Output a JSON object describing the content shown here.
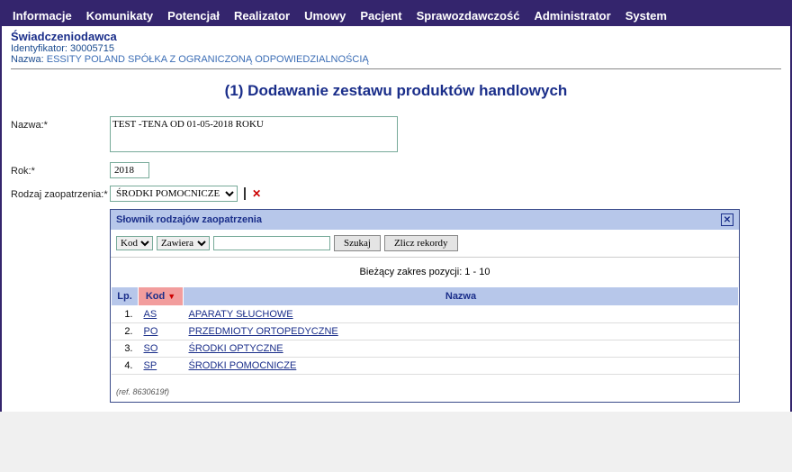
{
  "menu": {
    "items": [
      "Informacje",
      "Komunikaty",
      "Potencjał",
      "Realizator",
      "Umowy",
      "Pacjent",
      "Sprawozdawczość",
      "Administrator",
      "System"
    ]
  },
  "provider": {
    "title": "Świadczeniodawca",
    "id_label": "Identyfikator:",
    "id_value": "30005715",
    "name_label": "Nazwa:",
    "name_value": "ESSITY POLAND SPÓŁKA Z OGRANICZONĄ ODPOWIEDZIALNOŚCIĄ"
  },
  "page_title": "(1) Dodawanie zestawu produktów handlowych",
  "form": {
    "name_label": "Nazwa:*",
    "name_value": "TEST -TENA OD 01-05-2018 ROKU",
    "year_label": "Rok:*",
    "year_value": "2018",
    "supply_label": "Rodzaj zaopatrzenia:*",
    "supply_value": "ŚRODKI POMOCNICZE"
  },
  "dictionary": {
    "title": "Słownik rodzajów zaopatrzenia",
    "filter_field": "Kod",
    "filter_op": "Zawiera",
    "filter_value": "",
    "search_btn": "Szukaj",
    "count_btn": "Zlicz rekordy",
    "range_text": "Bieżący zakres pozycji: 1 - 10",
    "columns": {
      "lp": "Lp.",
      "kod": "Kod",
      "nazwa": "Nazwa"
    },
    "rows": [
      {
        "lp": "1.",
        "kod": "AS",
        "nazwa": "APARATY SŁUCHOWE"
      },
      {
        "lp": "2.",
        "kod": "PO",
        "nazwa": "PRZEDMIOTY ORTOPEDYCZNE"
      },
      {
        "lp": "3.",
        "kod": "SO",
        "nazwa": "ŚRODKI OPTYCZNE"
      },
      {
        "lp": "4.",
        "kod": "SP",
        "nazwa": "ŚRODKI POMOCNICZE"
      }
    ],
    "ref": "(ref. 8630619f)"
  }
}
